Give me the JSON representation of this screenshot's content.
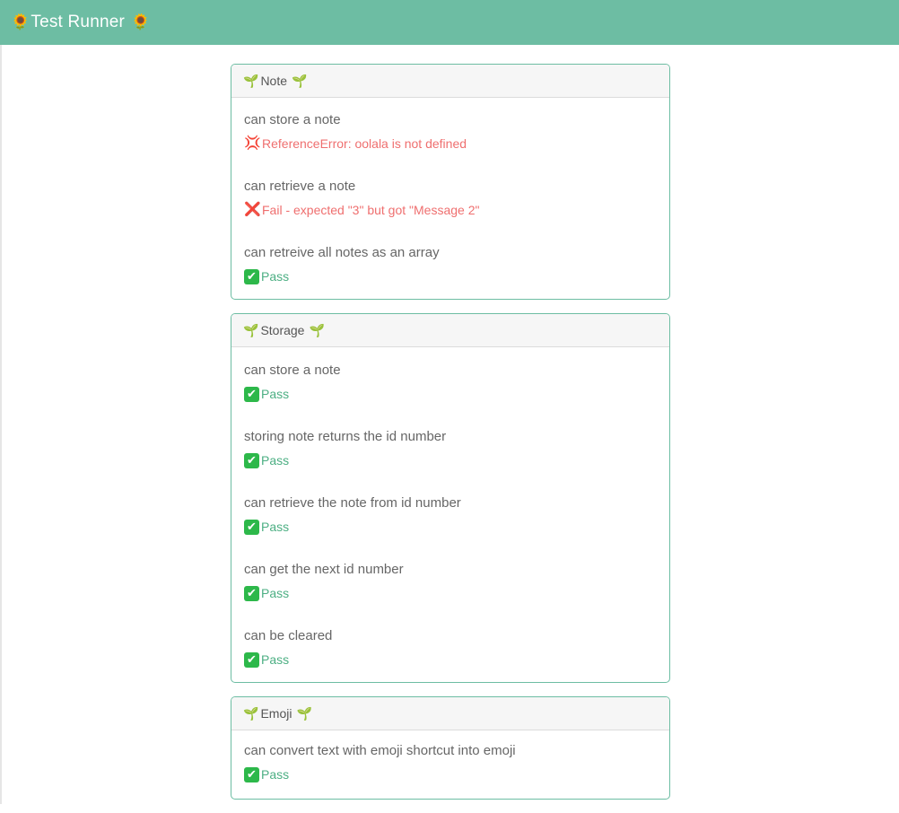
{
  "header": {
    "title": "Test Runner",
    "left_emoji": "🌻",
    "right_emoji": "🌻"
  },
  "colors": {
    "header_bg": "#6dbda3",
    "pass": "#4caf83",
    "fail": "#ef6f6f"
  },
  "suites": [
    {
      "name": "Note",
      "icon": "🌱",
      "tests": [
        {
          "name": "can store a note",
          "status": "error",
          "icon": "💢",
          "message": "ReferenceError: oolala is not defined"
        },
        {
          "name": "can retrieve a note",
          "status": "fail",
          "icon": "❌",
          "message": "Fail - expected \"3\" but got \"Message 2\""
        },
        {
          "name": "can retreive all notes as an array",
          "status": "pass",
          "icon": "✔",
          "message": "Pass"
        }
      ]
    },
    {
      "name": "Storage",
      "icon": "🌱",
      "tests": [
        {
          "name": "can store a note",
          "status": "pass",
          "icon": "✔",
          "message": "Pass"
        },
        {
          "name": "storing note returns the id number",
          "status": "pass",
          "icon": "✔",
          "message": "Pass"
        },
        {
          "name": "can retrieve the note from id number",
          "status": "pass",
          "icon": "✔",
          "message": "Pass"
        },
        {
          "name": "can get the next id number",
          "status": "pass",
          "icon": "✔",
          "message": "Pass"
        },
        {
          "name": "can be cleared",
          "status": "pass",
          "icon": "✔",
          "message": "Pass"
        }
      ]
    },
    {
      "name": "Emoji",
      "icon": "🌱",
      "tests": [
        {
          "name": "can convert text with emoji shortcut into emoji",
          "status": "pass",
          "icon": "✔",
          "message": "Pass"
        }
      ]
    }
  ]
}
